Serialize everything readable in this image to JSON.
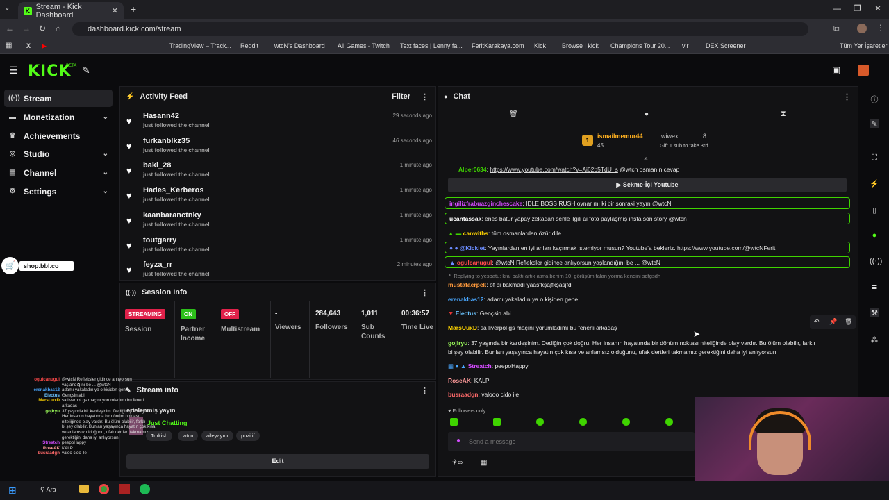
{
  "browser": {
    "tab_title": "Stream - Kick Dashboard",
    "url": "dashboard.kick.com/stream",
    "bookmarks": [
      "TradingView – Track...",
      "Reddit",
      "wtcN's Dashboard",
      "All Games - Twitch",
      "Text faces | Lenny fa...",
      "FeritKarakaya.com",
      "Kick",
      "Browse | kick",
      "Champions Tour 20...",
      "vlr",
      "DEX Screener"
    ],
    "all_bookmarks": "Tüm Yer İşaretleri"
  },
  "app": {
    "logo": "KICK",
    "beta": "BETA"
  },
  "sidebar": {
    "items": [
      {
        "label": "Stream",
        "icon": "broadcast-icon"
      },
      {
        "label": "Monetization",
        "icon": "money-icon"
      },
      {
        "label": "Achievements",
        "icon": "trophy-icon"
      },
      {
        "label": "Studio",
        "icon": "studio-icon"
      },
      {
        "label": "Channel",
        "icon": "channel-icon"
      },
      {
        "label": "Settings",
        "icon": "gear-icon"
      }
    ],
    "shop": "shop.bbl.co"
  },
  "activity": {
    "title": "Activity Feed",
    "filter": "Filter",
    "items": [
      {
        "name": "Hasann42",
        "sub": "just followed the channel",
        "time": "29 seconds ago"
      },
      {
        "name": "furkanblkz35",
        "sub": "just followed the channel",
        "time": "46 seconds ago"
      },
      {
        "name": "baki_28",
        "sub": "just followed the channel",
        "time": "1 minute ago"
      },
      {
        "name": "Hades_Kerberos",
        "sub": "just followed the channel",
        "time": "1 minute ago"
      },
      {
        "name": "kaanbaranctnky",
        "sub": "just followed the channel",
        "time": "1 minute ago"
      },
      {
        "name": "toutgarry",
        "sub": "just followed the channel",
        "time": "1 minute ago"
      },
      {
        "name": "feyza_rr",
        "sub": "just followed the channel",
        "time": "2 minutes ago"
      }
    ]
  },
  "session": {
    "title": "Session Info",
    "streaming": "STREAMING",
    "session_label": "Session",
    "on": "ON",
    "partner_label": "Partner Income",
    "off": "OFF",
    "multistream_label": "Multistream",
    "viewers_val": "-",
    "viewers_label": "Viewers",
    "followers_val": "284,643",
    "followers_label": "Followers",
    "subs_val": "1,011",
    "subs_label": "Sub Counts",
    "time_val": "00:36:57",
    "time_label": "Time Live"
  },
  "stream_info": {
    "title": "Stream info",
    "stream_title": "ertelenmiş yayın",
    "category": "Just Chatting",
    "tags": [
      "Turkish",
      "wtcn",
      "aileyayını",
      "pozitif"
    ],
    "edit": "Edit"
  },
  "chat": {
    "title": "Chat",
    "top_gifter": {
      "name": "ismailmemur44",
      "rank": "1",
      "count": "45",
      "second": "wiwex",
      "second_count": "8",
      "gift_text": "Gift 1 sub to take 3rd"
    },
    "messages": [
      {
        "user": "Alper0634",
        "text": "https://www.youtube.com/watch?v=Ai62b5TdU_s",
        "tail": "@wtcn osmanın cevap",
        "color": "#3fd400"
      },
      {
        "user": "",
        "text": "Sekme-İçi Youtube",
        "color": "#ffffff"
      },
      {
        "user": "ingilizfrabuazginchescake",
        "text": "IDLE BOSS RUSH oynar mı ki bir sonraki yayın @wtcN",
        "color": "#d44cff"
      },
      {
        "user": "ucantassak",
        "text": "enes batur yapay zekadan senle ilgili ai foto paylaşmış insta son story @wtcn",
        "color": "#ffffff"
      },
      {
        "user": "canwiths",
        "text": "tüm osmanlardan özür dile",
        "color": "#ffd400"
      },
      {
        "user": "@Kickiet",
        "text": "Yayınlardan en iyi anları kaçırmak istemiyor musun? Youtube'a bekleriz. ",
        "link": "https://www.youtube.com/@wtcNFerit",
        "color": "#6b8cff"
      },
      {
        "user": "ogulcanugul",
        "text": "@wtcN Refleksler gidince anlıyorsun yaşlandığını be ... @wtcN",
        "color": "#ff4a4a"
      },
      {
        "user": "",
        "text": "Replying to yesbatu: kral baktı artık atma benim 10. görüşüm falan yorma kendini sdfgsdh",
        "color": "#888888"
      },
      {
        "user": "mustafaerpek",
        "text": "of bi bakmadı yaasfkşajfkşasjfd",
        "color": "#ff9a3c"
      },
      {
        "user": "erenakbas12",
        "text": "adamı yakaladın ya o kişiden gene",
        "color": "#4aa8ff"
      },
      {
        "user": "Electus",
        "text": "Gençsin abi",
        "color": "#6bc4ff"
      },
      {
        "user": "MarsUuxD",
        "text": "sa liverpol gs maçını yorumladımı bu fenerli arkadaş",
        "color": "#ffd400"
      },
      {
        "user": "gojiryu",
        "text": "37 yaşında bir kardeşinim. Dediğin çok doğru. Her insanın hayatında bir dönüm noktası niteliğinde olay vardır. Bu ölüm olabilir, farklı",
        "line2": "bi şey olabilir. Bunları yaşayınca hayatın çok kısa ve anlamsız olduğunu, ufak dertleri takmamız gerektiğini daha iyi anlıyorsun",
        "color": "#9dff5a"
      },
      {
        "user": "Streatch",
        "text": "peepoHappy",
        "color": "#d44cff"
      },
      {
        "user": "RoseAK",
        "text": "KALP",
        "color": "#ff9a9a"
      },
      {
        "user": "busraadgn",
        "text": "valooo cido ile",
        "color": "#ff6a6a"
      }
    ],
    "followers_only": "Followers only",
    "placeholder": "Send a message"
  },
  "overlay_chat": [
    {
      "n": "ogulcanugul",
      "t": "@wtcN Refleksler gidince anlıyorsun"
    },
    {
      "n": "",
      "t": "yaşlandığını be ... @wtcN"
    },
    {
      "n": "erenakbas12",
      "t": "adamı yakaladın ya o kişiden gene"
    },
    {
      "n": "Electus",
      "t": "Gençsin abi"
    },
    {
      "n": "MarsUuxD",
      "t": "sa liverpol gs maçını yorumladımı bu fenerli"
    },
    {
      "n": "",
      "t": "arkadaş"
    },
    {
      "n": "gojiryu",
      "t": "37 yaşında bir kardeşinim. Dediğin çok doğru."
    },
    {
      "n": "",
      "t": "Her insanın hayatında bir dönüm noktası"
    },
    {
      "n": "",
      "t": "niteliğinde olay vardır. Bu ölüm olabilir, farklı"
    },
    {
      "n": "",
      "t": "bi şey olabilir. Bunları yaşayınca hayatın çok kısa"
    },
    {
      "n": "",
      "t": "ve anlamsız olduğunu, ufak dertleri takmamız"
    },
    {
      "n": "",
      "t": "gerektiğini daha iyi anlıyorsun"
    },
    {
      "n": "Streatch",
      "t": "peepoHappy"
    },
    {
      "n": "RoseAK",
      "t": "KALP"
    },
    {
      "n": "busraadgn",
      "t": "valoo cido ile"
    }
  ],
  "taskbar": {
    "search": "Ara"
  }
}
